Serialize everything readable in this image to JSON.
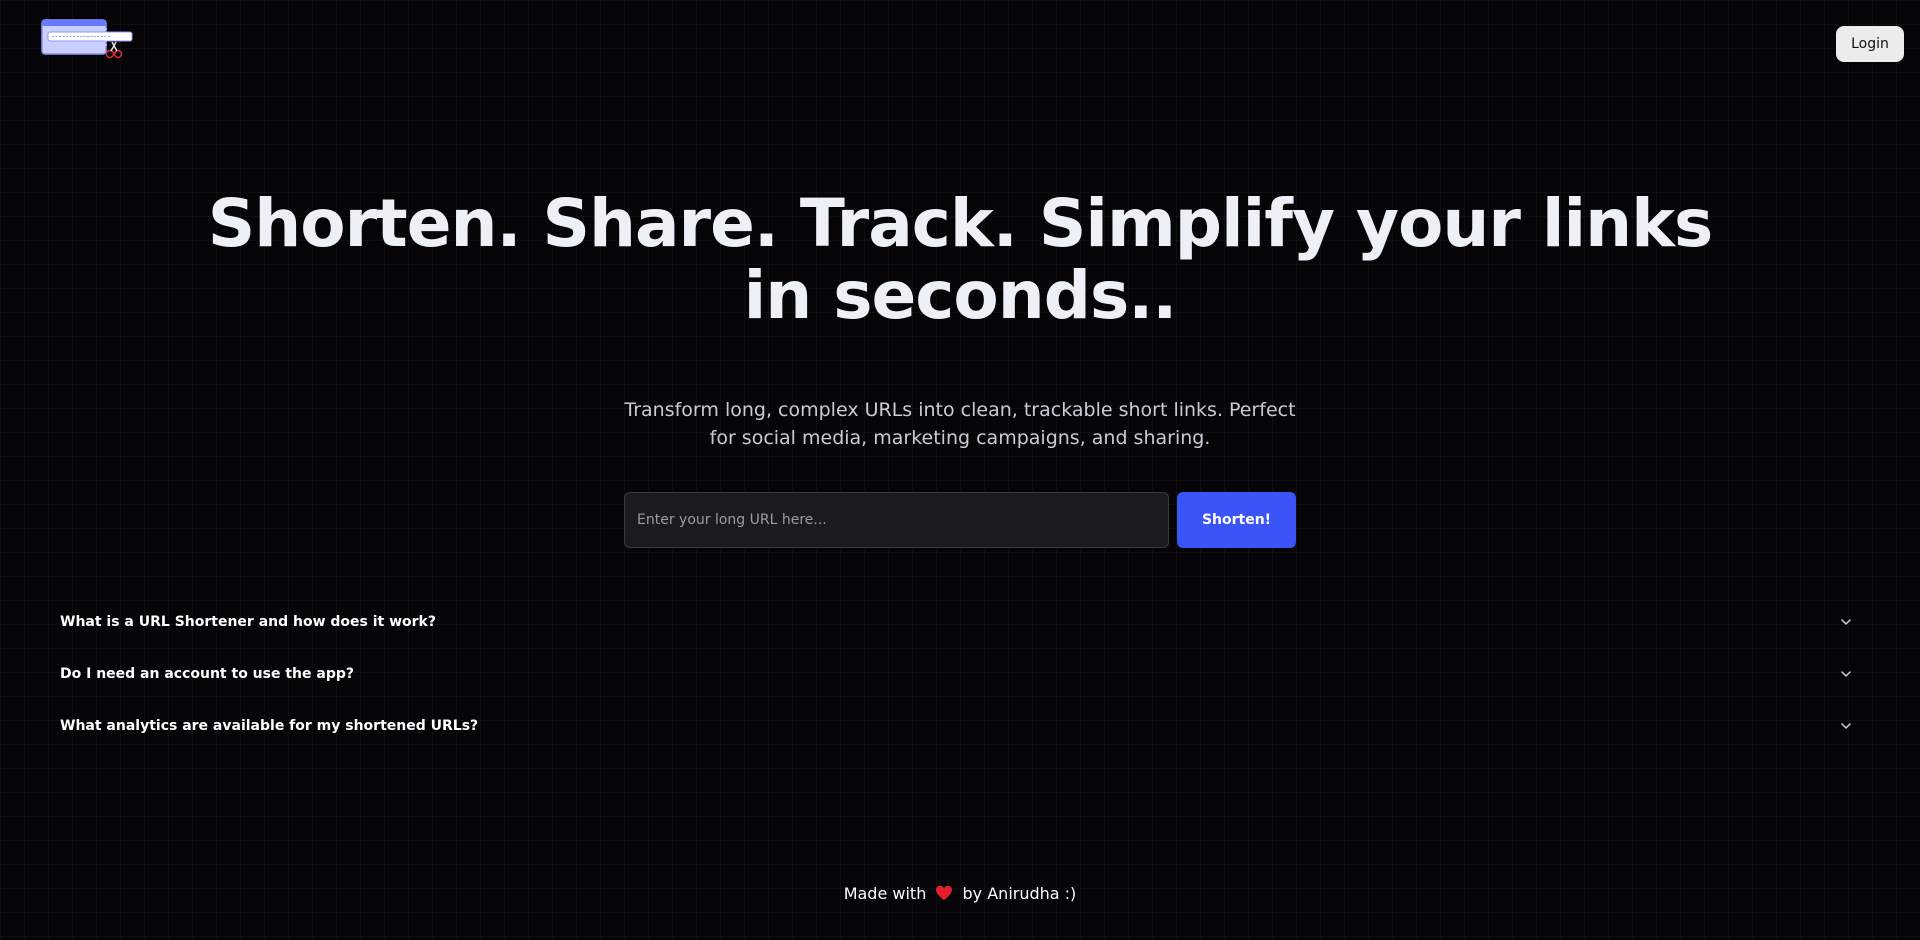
{
  "header": {
    "logo_icon": "url-scissors-logo-icon",
    "login_label": "Login"
  },
  "hero": {
    "title": "Shorten. Share. Track. Simplify your links in seconds..",
    "subtitle": "Transform long, complex URLs into clean, trackable short links. Perfect for social media, marketing campaigns, and sharing."
  },
  "form": {
    "url_placeholder": "Enter your long URL here...",
    "url_value": "",
    "submit_label": "Shorten!"
  },
  "faq": {
    "items": [
      {
        "question": "What is a URL Shortener and how does it work?",
        "icon": "chevron-down-icon"
      },
      {
        "question": "Do I need an account to use the app?",
        "icon": "chevron-down-icon"
      },
      {
        "question": "What analytics are available for my shortened URLs?",
        "icon": "chevron-down-icon"
      }
    ]
  },
  "footer": {
    "prefix": "Made with",
    "heart_icon": "heart-icon",
    "suffix": "by Anirudha :)"
  },
  "colors": {
    "background": "#050507",
    "accent": "#3b54f7",
    "heart": "#e11d2e"
  }
}
